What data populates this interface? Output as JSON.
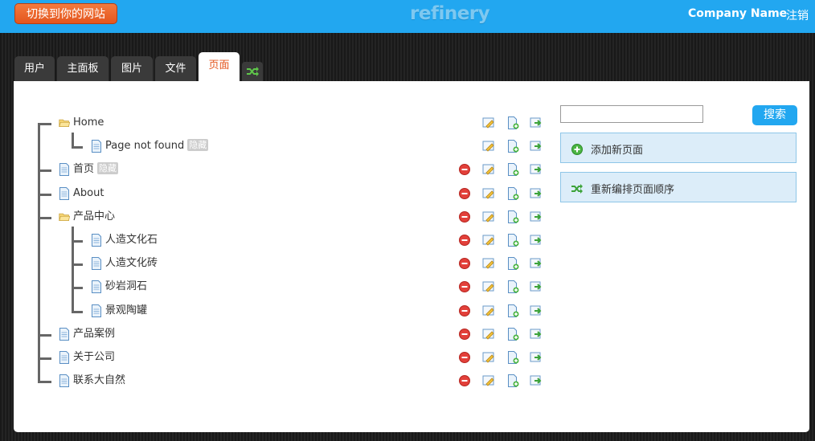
{
  "header": {
    "switch_label": "切换到你的网站",
    "logo_text": "refinery",
    "company_name": "Company Name",
    "logout_label": "注销"
  },
  "tabs": [
    {
      "label": "用户"
    },
    {
      "label": "主面板"
    },
    {
      "label": "图片"
    },
    {
      "label": "文件"
    },
    {
      "label": "页面",
      "active": true
    }
  ],
  "tab_icon": "shuffle-icon",
  "search": {
    "placeholder": "",
    "button_label": "搜索"
  },
  "side_actions": [
    {
      "label": "添加新页面",
      "icon": "add-icon"
    },
    {
      "label": "重新编排页面顺序",
      "icon": "reorder-icon"
    }
  ],
  "pages": [
    {
      "title": "Home",
      "type": "folder",
      "children": [
        {
          "title": "Page not found",
          "badge": "隐藏"
        }
      ]
    },
    {
      "title": "首页",
      "badge": "隐藏",
      "deletable": true
    },
    {
      "title": "About",
      "deletable": true
    },
    {
      "title": "产品中心",
      "type": "folder",
      "deletable": true,
      "children": [
        {
          "title": "人造文化石",
          "deletable": true
        },
        {
          "title": "人造文化砖",
          "deletable": true
        },
        {
          "title": "砂岩洞石",
          "deletable": true
        },
        {
          "title": "景观陶罐",
          "deletable": true
        }
      ]
    },
    {
      "title": "产品案例",
      "deletable": true
    },
    {
      "title": "关于公司",
      "deletable": true
    },
    {
      "title": "联系大自然",
      "deletable": true
    }
  ],
  "colors": {
    "topbar": "#22a7f0",
    "switch_button": "#e4561e",
    "active_tab_text": "#e4561e",
    "side_action_bg": "#dcedf9"
  }
}
